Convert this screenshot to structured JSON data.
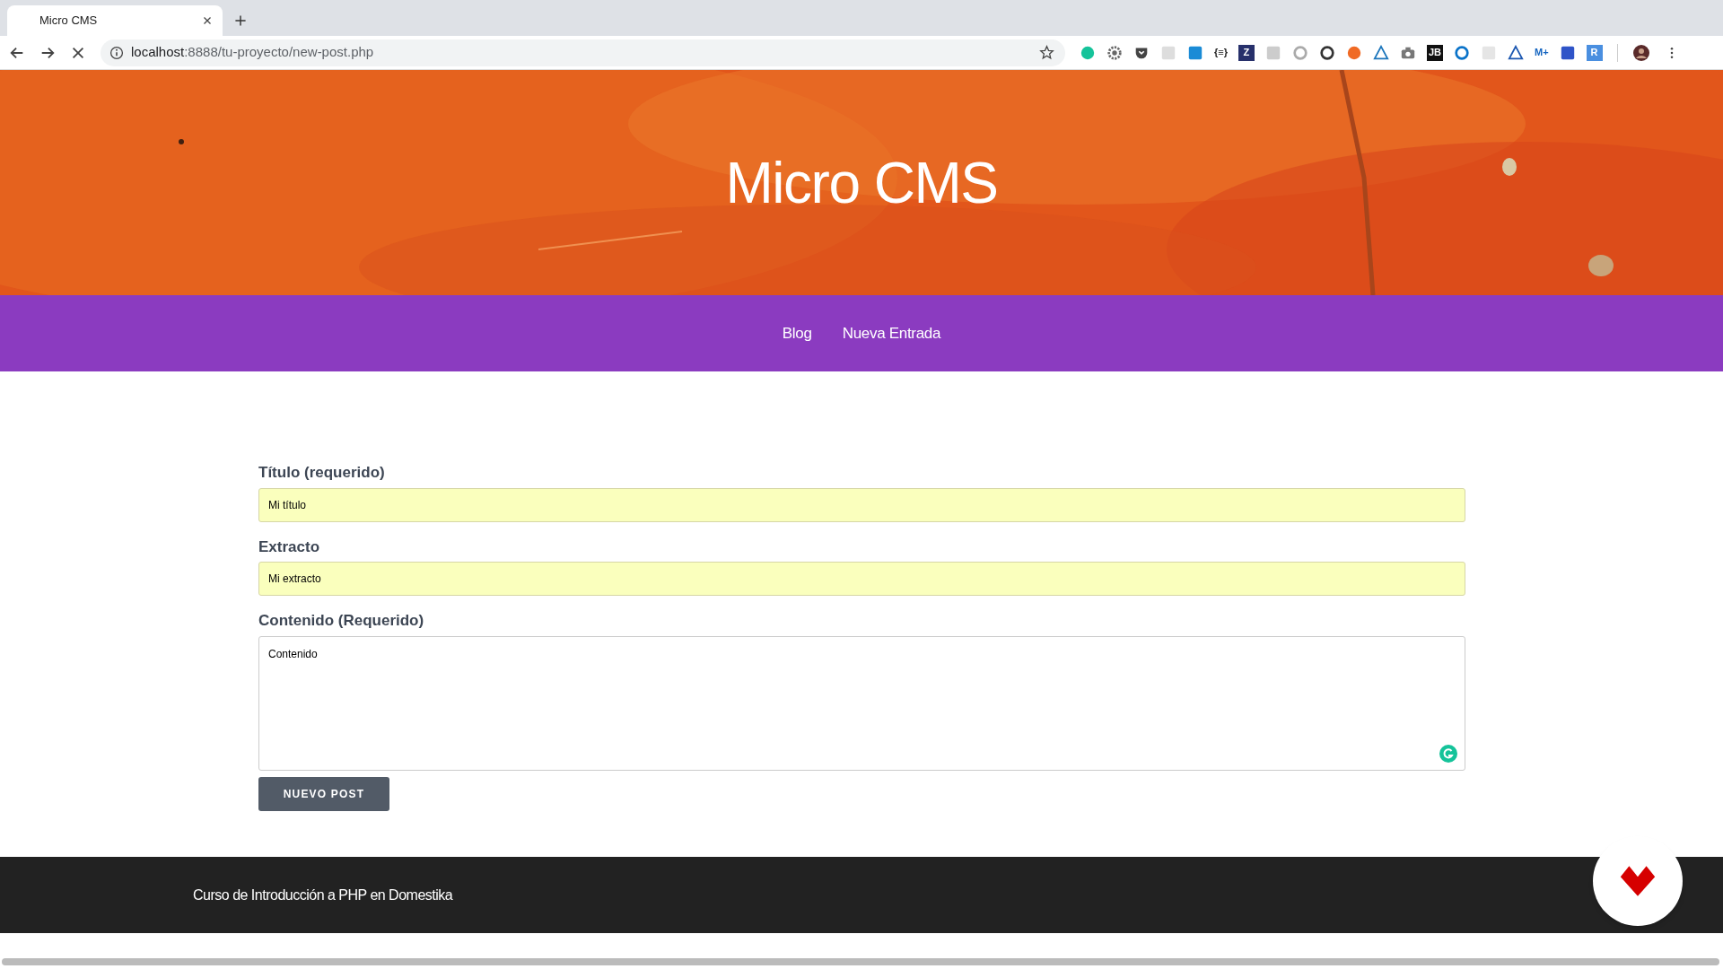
{
  "browser": {
    "tab": {
      "title": "Micro CMS",
      "selected": true
    },
    "loading": true,
    "url_host": "localhost",
    "url_path": ":8888/tu-proyecto/new-post.php",
    "extensions": [
      {
        "kind": "circle",
        "color": "#15c39a"
      },
      {
        "kind": "gear",
        "color": "#666666"
      },
      {
        "kind": "pocket",
        "color": "#444444"
      },
      {
        "kind": "square",
        "color": "#dddddd"
      },
      {
        "kind": "square",
        "color": "#1a8bd6"
      },
      {
        "kind": "letter",
        "label": "{≡}",
        "color": "#222222"
      },
      {
        "kind": "tile",
        "label": "Z",
        "color": "#27306b"
      },
      {
        "kind": "square",
        "color": "#cccccc"
      },
      {
        "kind": "ring",
        "color": "#aaaaaa"
      },
      {
        "kind": "ring",
        "color": "#333333"
      },
      {
        "kind": "circle",
        "color": "#f06a24"
      },
      {
        "kind": "triangle",
        "color": "#1b75bb"
      },
      {
        "kind": "camera",
        "color": "#777777"
      },
      {
        "kind": "tile",
        "label": "JB",
        "color": "#111111"
      },
      {
        "kind": "ring",
        "color": "#0a73c9"
      },
      {
        "kind": "square",
        "color": "#e5e5e5"
      },
      {
        "kind": "triangle",
        "color": "#1a56b0"
      },
      {
        "kind": "letter",
        "label": "M+",
        "color": "#1565c0"
      },
      {
        "kind": "square",
        "color": "#2f54c8"
      },
      {
        "kind": "tile",
        "label": "R",
        "color": "#4a8fe0"
      }
    ]
  },
  "site": {
    "title": "Micro CMS",
    "nav": [
      {
        "label": "Blog"
      },
      {
        "label": "Nueva Entrada"
      }
    ]
  },
  "form": {
    "fields": [
      {
        "kind": "input",
        "label": "Título (requerido)",
        "value": "Mi título",
        "autofilled": true
      },
      {
        "kind": "input",
        "label": "Extracto",
        "value": "Mi extracto",
        "autofilled": true
      },
      {
        "kind": "textarea",
        "label": "Contenido (Requerido)",
        "value": "Contenido",
        "autofilled": false
      }
    ],
    "submit": "NUEVO POST"
  },
  "footer": {
    "text": "Curso de Introducción a PHP en Domestika"
  }
}
